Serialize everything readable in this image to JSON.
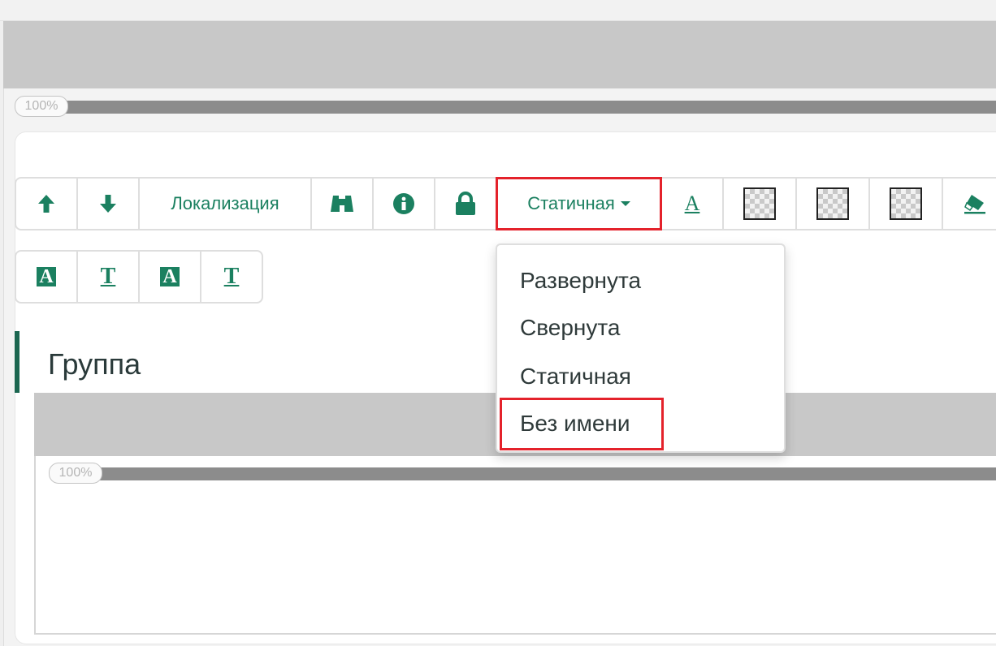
{
  "zoom": {
    "top_label": "100%",
    "inner_label": "100%"
  },
  "toolbar": {
    "localization_label": "Локализация",
    "style_selected": "Статичная"
  },
  "group": {
    "title": "Группа"
  },
  "dropdown": {
    "options": [
      {
        "label": "Развернута"
      },
      {
        "label": "Свернута"
      },
      {
        "label": "Статичная"
      },
      {
        "label": "Без имени"
      }
    ],
    "highlighted": "Без имени"
  },
  "colors": {
    "accent_green": "#1b8060",
    "highlight_red": "#e4222b",
    "gray_band": "#c8c8c8",
    "zoom_bar": "#8c8c8c"
  },
  "icons": {
    "move_up": "arrow-up-icon",
    "move_down": "arrow-down-icon",
    "find": "binoculars-icon",
    "info": "info-icon",
    "lock": "lock-icon",
    "text_color": "text-color-icon",
    "swatch": "transparent-swatch-icon",
    "eraser": "eraser-icon"
  }
}
